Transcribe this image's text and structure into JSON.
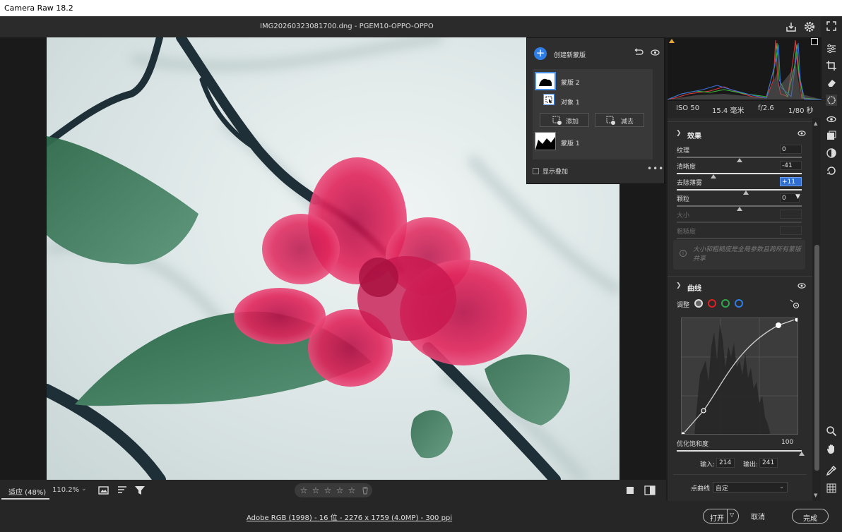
{
  "app": {
    "title": "Camera Raw 18.2"
  },
  "file": {
    "name": "IMG20260323081700.dng  -  PGEM10-OPPO-OPPO"
  },
  "mask_panel": {
    "create_label": "创建新蒙版",
    "masks": [
      {
        "label": "蒙版 2",
        "components": [
          {
            "label": "对象 1"
          }
        ],
        "selected": true
      },
      {
        "label": "蒙版 1",
        "selected": false
      }
    ],
    "add_label": "添加",
    "subtract_label": "减去",
    "show_overlay_label": "显示叠加"
  },
  "exif": {
    "iso": "ISO 50",
    "focal": "15.4 毫米",
    "aperture": "f/2.6",
    "shutter": "1/80 秒"
  },
  "effects": {
    "title": "效果",
    "texture": {
      "label": "纹理",
      "value": "0",
      "level": 0.5
    },
    "clarity": {
      "label": "清晰度",
      "value": "-41",
      "level": 0.295
    },
    "dehaze": {
      "label": "去除薄雾",
      "value": "+11",
      "level": 0.555
    },
    "grain": {
      "label": "颗粒",
      "value": "0",
      "level": 0.5
    },
    "size": {
      "label": "大小"
    },
    "roughness": {
      "label": "粗糙度"
    },
    "note": "大小和粗糙度是全局参数且跨所有蒙版共享"
  },
  "curve": {
    "title": "曲线",
    "adjust_label": "调整",
    "refine_saturation": {
      "label": "优化饱和度",
      "value": "100",
      "level": 1.0
    },
    "input_label": "输入:",
    "input_value": "214",
    "output_label": "输出:",
    "output_value": "241",
    "point_curve_label": "点曲线",
    "point_curve_value": "自定",
    "channel_colors": {
      "rgb": "#dddddd",
      "red": "#e02020",
      "green": "#2ea84a",
      "blue": "#2f7ee6"
    }
  },
  "view": {
    "fit_label": "适应 (48%)",
    "zoom_label": "110.2%",
    "stars": [
      "☆",
      "☆",
      "☆",
      "☆",
      "☆"
    ]
  },
  "footer": {
    "info": "Adobe RGB (1998) - 16 位 - 2276 x 1759 (4.0MP) - 300 ppi",
    "open_label": "打开",
    "cancel_label": "取消",
    "done_label": "完成"
  },
  "colors": {
    "accent": "#2f7ee6",
    "panel_bg": "#2b2b2b",
    "petal": "#e0245a",
    "leaf": "#3f7a5a"
  }
}
